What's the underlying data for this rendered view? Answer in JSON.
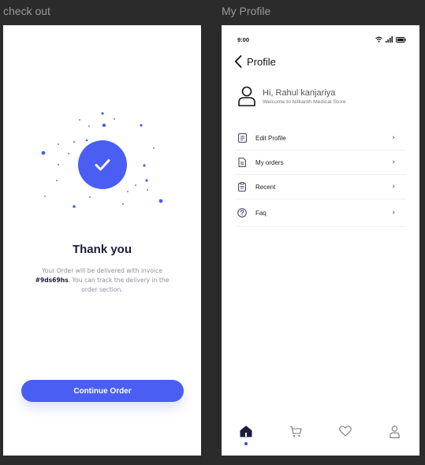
{
  "screens": {
    "checkout": {
      "frame_label": "check out",
      "title": "Thank you",
      "message_pre": "Your Order will be delivered with invoice",
      "invoice": "#9ds69hs",
      "message_post": ". You can track the delivery in the order section.",
      "button_label": "Continue Order"
    },
    "profile": {
      "frame_label": "My Profile",
      "status_time": "9:00",
      "title": "Profile",
      "greeting": "Hi, Rahul kanjariya",
      "welcome": "Welcome to  Nilkanth Medical Store",
      "menu": [
        {
          "label": "Edit Profile",
          "icon": "edit-profile-icon"
        },
        {
          "label": "My orders",
          "icon": "document-icon"
        },
        {
          "label": "Recent",
          "icon": "clipboard-icon"
        },
        {
          "label": "Faq",
          "icon": "help-icon"
        }
      ],
      "chevron": "›",
      "nav_items": [
        "home-icon",
        "cart-icon",
        "heart-icon",
        "user-icon"
      ],
      "active_nav": "home"
    }
  },
  "colors": {
    "accent": "#4a5ef4",
    "nav_active": "#3249d6",
    "background": "#2b2b2b"
  }
}
